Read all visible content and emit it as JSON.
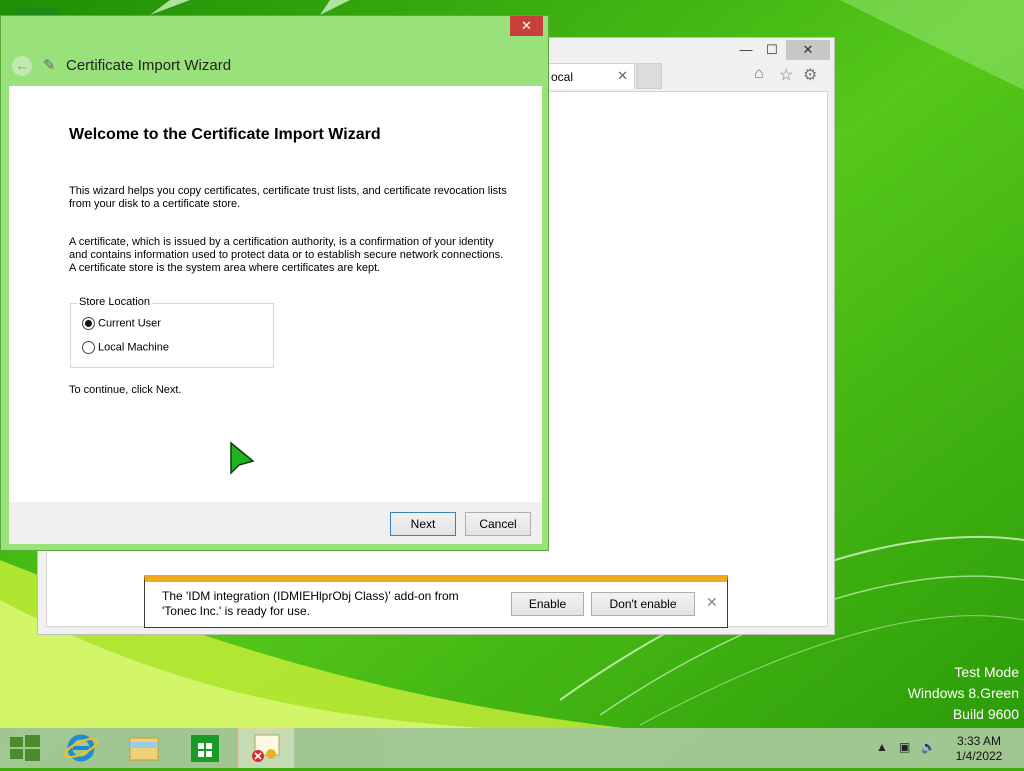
{
  "browser": {
    "tab_label": "ocal",
    "tab_close": "✕",
    "minimize": "—",
    "maximize": "☐",
    "close": "✕"
  },
  "notification": {
    "message": "The 'IDM integration (IDMIEHlprObj Class)' add-on from 'Tonec Inc.' is ready for use.",
    "enable_label": "Enable",
    "dont_enable_label": "Don't enable",
    "close_label": "✕",
    "accent_color": "#f0a91b"
  },
  "wizard": {
    "title": "Certificate Import Wizard",
    "close_label": "✕",
    "back_label": "←",
    "heading": "Welcome to the Certificate Import Wizard",
    "paragraph1": "This wizard helps you copy certificates, certificate trust lists, and certificate revocation lists from your disk to a certificate store.",
    "paragraph2": "A certificate, which is issued by a certification authority, is a confirmation of your identity and contains information used to protect data or to establish secure network connections. A certificate store is the system area where certificates are kept.",
    "store_location": {
      "label": "Store Location",
      "options": [
        {
          "label": "Current User",
          "selected": true
        },
        {
          "label": "Local Machine",
          "selected": false
        }
      ]
    },
    "continue_text": "To continue, click Next.",
    "next_label": "Next",
    "cancel_label": "Cancel"
  },
  "watermark": {
    "line1": "Test Mode",
    "line2": "Windows 8.Green",
    "line3": "Build 9600"
  },
  "taskbar": {
    "items": [
      "start-button",
      "internet-explorer",
      "file-explorer",
      "store",
      "certificate-wizard"
    ],
    "clock_time": "3:33 AM",
    "clock_date": "1/4/2022"
  }
}
